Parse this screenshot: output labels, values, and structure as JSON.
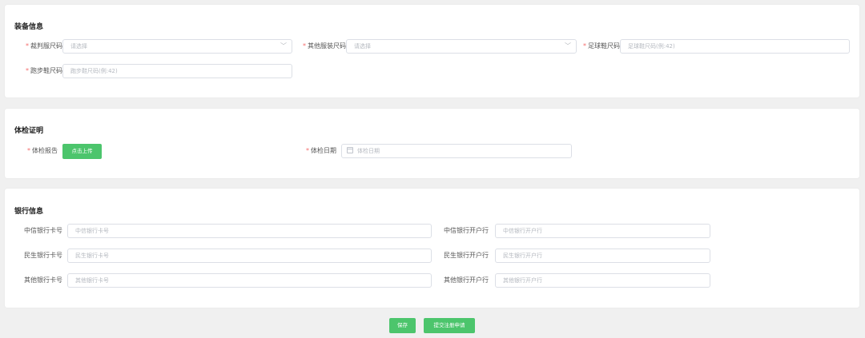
{
  "equipment": {
    "title": "装备信息",
    "referee_size": {
      "label": "裁判服尺码",
      "placeholder": "请选择"
    },
    "other_size": {
      "label": "其他服装尺码",
      "placeholder": "请选择"
    },
    "football_shoe": {
      "label": "足球鞋尺码",
      "placeholder": "足球鞋尺码(例:42)"
    },
    "running_shoe": {
      "label": "跑步鞋尺码",
      "placeholder": "跑步鞋尺码(例:42)"
    }
  },
  "medical": {
    "title": "体检证明",
    "report": {
      "label": "体检报告",
      "button": "点击上传"
    },
    "date": {
      "label": "体检日期",
      "placeholder": "体检日期"
    }
  },
  "bank": {
    "title": "银行信息",
    "rows": [
      {
        "card_label": "中信银行卡号",
        "card_placeholder": "中信银行卡号",
        "branch_label": "中信银行开户行",
        "branch_placeholder": "中信银行开户行"
      },
      {
        "card_label": "民生银行卡号",
        "card_placeholder": "民生银行卡号",
        "branch_label": "民生银行开户行",
        "branch_placeholder": "民生银行开户行"
      },
      {
        "card_label": "其他银行卡号",
        "card_placeholder": "其他银行卡号",
        "branch_label": "其他银行开户行",
        "branch_placeholder": "其他银行开户行"
      }
    ]
  },
  "actions": {
    "save": "保存",
    "submit": "提交注册申请"
  },
  "colors": {
    "required": "#f56c6c",
    "primary": "#4cc56c",
    "background": "#f0f0f0"
  }
}
